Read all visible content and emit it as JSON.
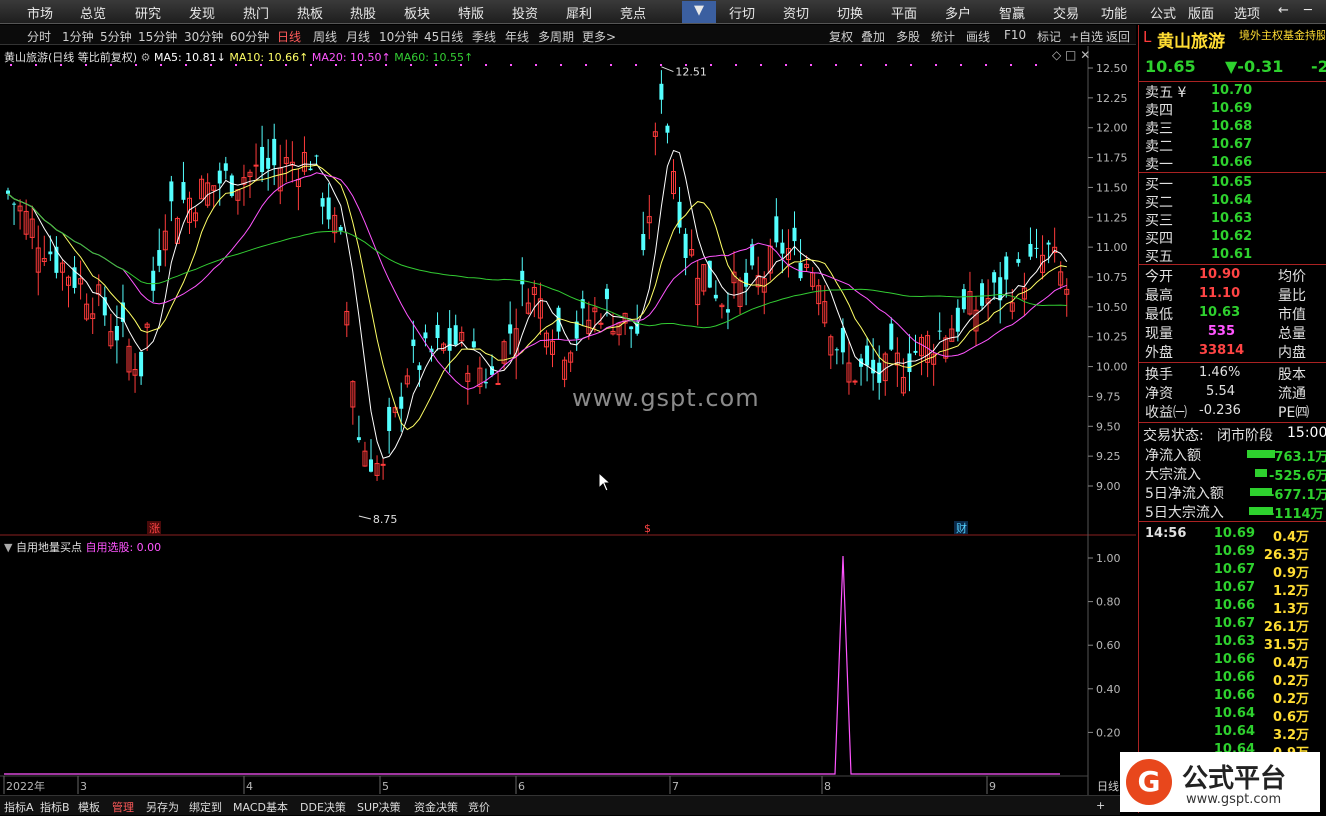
{
  "menu": [
    "市场",
    "总览",
    "研究",
    "发现",
    "热门",
    "热板",
    "热股",
    "板块",
    "特版",
    "投资",
    "犀利",
    "竞点",
    "▼",
    "行切",
    "资切",
    "切换",
    "平面",
    "多户",
    "智赢",
    "交易",
    "功能",
    "公式",
    "版面",
    "选项"
  ],
  "window_controls": [
    "←",
    "─"
  ],
  "periods": [
    "分时",
    "1分钟",
    "5分钟",
    "15分钟",
    "30分钟",
    "60分钟",
    "日线",
    "周线",
    "月线",
    "10分钟",
    "45日线",
    "季线",
    "年线",
    "多周期",
    "更多>"
  ],
  "active_period": "日线",
  "toolbar": [
    "复权",
    "叠加",
    "多股",
    "统计",
    "画线",
    "F10",
    "标记",
    "+自选",
    "返回"
  ],
  "legend": {
    "title": "黄山旅游(日线 等比前复权)",
    "ma5": "MA5: 10.81↓",
    "ma10": "MA10: 10.66↑",
    "ma20": "MA20: 10.50↑",
    "ma60": "MA60: 10.55↑"
  },
  "indicator_legend": {
    "name": "自用地量买点",
    "param": "自用选股: 0.00"
  },
  "price_axis": [
    "12.50",
    "12.25",
    "12.00",
    "11.75",
    "11.50",
    "11.25",
    "11.00",
    "10.75",
    "10.50",
    "10.25",
    "10.00",
    "9.75",
    "9.50",
    "9.25",
    "9.00"
  ],
  "ind_axis": [
    "1.00",
    "0.80",
    "0.60",
    "0.40",
    "0.20"
  ],
  "high_label": "12.51",
  "low_label": "8.75",
  "markers": [
    "涨",
    "$",
    "财"
  ],
  "watermark": "www.gspt.com",
  "date_axis": [
    "2022年",
    "3",
    "4",
    "5",
    "6",
    "7",
    "8",
    "9"
  ],
  "right_axis_label": "日线",
  "stock": {
    "flag": "L",
    "name": "黄山旅游",
    "ticker_scroll": "境外主权基金持股",
    "price": "10.65",
    "change": "▼-0.31",
    "pct": "-2"
  },
  "asks": [
    {
      "label": "卖五 ¥",
      "price": "10.70"
    },
    {
      "label": "卖四",
      "price": "10.69"
    },
    {
      "label": "卖三",
      "price": "10.68"
    },
    {
      "label": "卖二",
      "price": "10.67"
    },
    {
      "label": "卖一",
      "price": "10.66"
    }
  ],
  "bids": [
    {
      "label": "买一",
      "price": "10.65"
    },
    {
      "label": "买二",
      "price": "10.64"
    },
    {
      "label": "买三",
      "price": "10.63"
    },
    {
      "label": "买四",
      "price": "10.62"
    },
    {
      "label": "买五",
      "price": "10.61"
    }
  ],
  "stats": [
    {
      "l": "今开",
      "v": "10.90",
      "r": "均价",
      "c": "#ff4444"
    },
    {
      "l": "最高",
      "v": "11.10",
      "r": "量比",
      "c": "#ff4444"
    },
    {
      "l": "最低",
      "v": "10.63",
      "r": "市值",
      "c": "#2ed12e"
    },
    {
      "l": "现量",
      "v": "535",
      "r": "总量",
      "c": "#ff55ff"
    },
    {
      "l": "外盘",
      "v": "33814",
      "r": "内盘",
      "c": "#ff4444"
    }
  ],
  "stats2": [
    {
      "l": "换手",
      "v": "1.46%",
      "r": "股本"
    },
    {
      "l": "净资",
      "v": "5.54",
      "r": "流通"
    },
    {
      "l": "收益㈠",
      "v": "-0.236",
      "r": "PE㈣"
    }
  ],
  "status": {
    "label": "交易状态:",
    "value": "闭市阶段",
    "time": "15:00"
  },
  "flows": [
    {
      "l": "净流入额",
      "v": "-763.1万",
      "w": 28
    },
    {
      "l": "大宗流入",
      "v": "-525.6万",
      "w": 12
    },
    {
      "l": "5日净流入额",
      "v": "-677.1万",
      "w": 22
    },
    {
      "l": "5日大宗流入",
      "v": "-1114万",
      "w": 24
    }
  ],
  "ticks_time": "14:56",
  "ticks": [
    {
      "p": "10.69",
      "v": "0.4万"
    },
    {
      "p": "10.69",
      "v": "26.3万"
    },
    {
      "p": "10.67",
      "v": "0.9万"
    },
    {
      "p": "10.67",
      "v": "1.2万"
    },
    {
      "p": "10.66",
      "v": "1.3万"
    },
    {
      "p": "10.67",
      "v": "26.1万"
    },
    {
      "p": "10.63",
      "v": "31.5万"
    },
    {
      "p": "10.66",
      "v": "0.4万"
    },
    {
      "p": "10.66",
      "v": "0.2万"
    },
    {
      "p": "10.66",
      "v": "0.2万"
    },
    {
      "p": "10.64",
      "v": "0.6万"
    },
    {
      "p": "10.64",
      "v": "3.2万"
    },
    {
      "p": "10.64",
      "v": "0.9万"
    }
  ],
  "bottom_tabs": [
    "指标A",
    "指标B",
    "模板",
    "管理",
    "另存为",
    "绑定到",
    "MACD基本",
    "DDE决策",
    "SUP决策",
    "资金决策",
    "竞价"
  ],
  "active_bottom_tab": "管理",
  "logo": {
    "badge": "G",
    "text": "公式平台",
    "url": "www.gspt.com"
  },
  "colors": {
    "up": "#ff3b3b",
    "down": "#54ffff",
    "ma5": "#ffffff",
    "ma10": "#ffff66",
    "ma20": "#ff55ff",
    "ma60": "#33cc33",
    "indicator": "#ff55ff"
  },
  "chart_data": {
    "type": "candlestick",
    "title": "黄山旅游(日线 等比前复权)",
    "ylim": [
      8.75,
      12.6
    ],
    "high": 12.51,
    "low": 8.75,
    "last": {
      "open": 10.9,
      "high": 11.1,
      "low": 10.63,
      "close": 10.65
    },
    "indicator": {
      "name": "自用地量买点",
      "ylim": [
        0,
        1.0
      ],
      "spike_value": 1.0,
      "spike_month": "8"
    }
  }
}
